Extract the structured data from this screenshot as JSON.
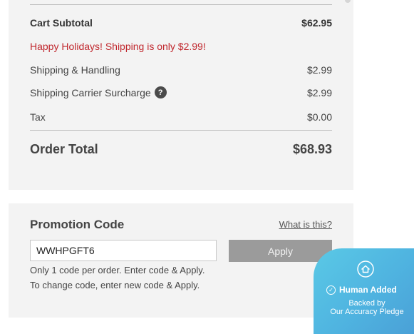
{
  "summary": {
    "subtotal_label": "Cart Subtotal",
    "subtotal_value": "$62.95",
    "promo_message": "Happy Holidays! Shipping is only $2.99!",
    "shipping_label": "Shipping & Handling",
    "shipping_value": "$2.99",
    "surcharge_label": "Shipping Carrier Surcharge",
    "surcharge_help": "?",
    "surcharge_value": "$2.99",
    "tax_label": "Tax",
    "tax_value": "$0.00",
    "total_label": "Order Total",
    "total_value": "$68.93"
  },
  "promo": {
    "title": "Promotion Code",
    "what_link": "What is this?",
    "code_value": "WWHPGFT6",
    "apply_label": "Apply",
    "hint_line1": "Only 1 code per order. Enter code & Apply.",
    "hint_line2": "To change code, enter new code & Apply."
  },
  "badge": {
    "icon": "house-icon",
    "title": "Human Added",
    "line1": "Backed by",
    "line2": "Our Accuracy Pledge"
  },
  "colors": {
    "panel": "#f3f3f3",
    "promo_message": "#c0272d",
    "apply_button": "#9b9b9b",
    "badge": "#4fb3e0"
  }
}
